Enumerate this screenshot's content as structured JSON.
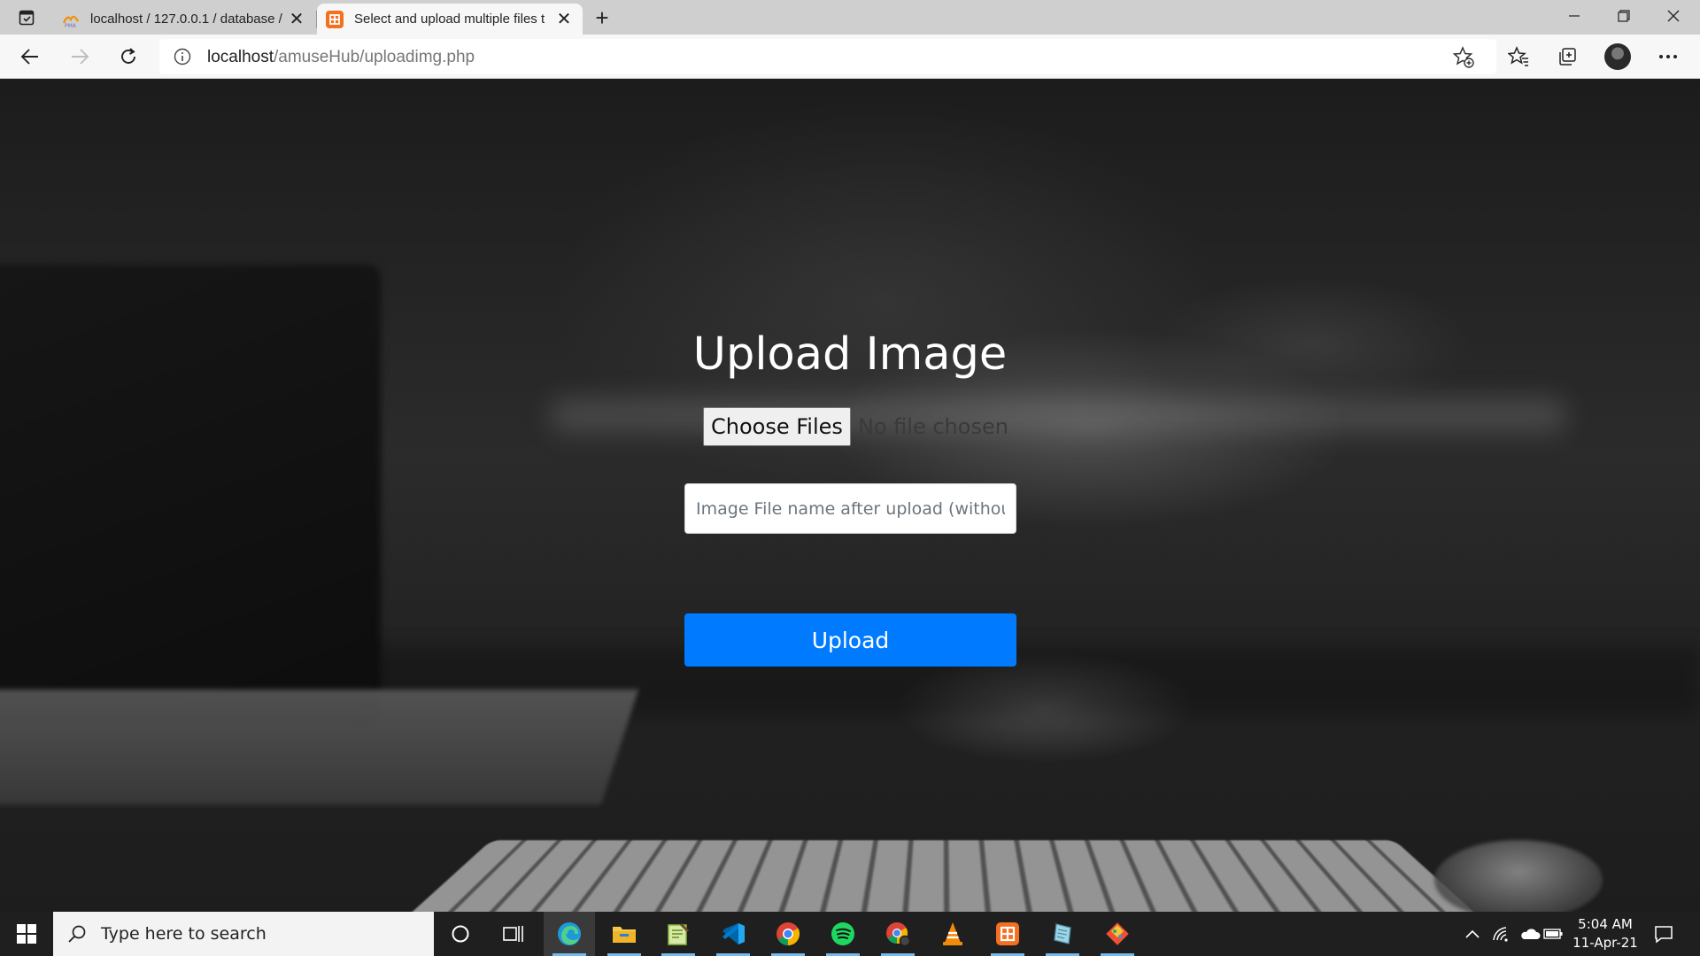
{
  "browser": {
    "tabs": [
      {
        "title": "localhost / 127.0.0.1 / database /",
        "active": false,
        "favicon": "phpmyadmin-icon"
      },
      {
        "title": "Select and upload multiple files t",
        "active": true,
        "favicon": "xampp-icon"
      }
    ],
    "url": {
      "host": "localhost",
      "path": "/amuseHub/uploadimg.php"
    }
  },
  "page": {
    "title": "Upload Image",
    "file_input": {
      "button_label": "Choose Files",
      "status": "No file chosen"
    },
    "name_input": {
      "placeholder": "Image File name after upload (without extension)",
      "value": ""
    },
    "submit_label": "Upload",
    "accent_color": "#007bff"
  },
  "taskbar": {
    "search_placeholder": "Type here to search",
    "apps": [
      "cortana-icon",
      "task-view-icon",
      "edge-icon",
      "file-explorer-icon",
      "notepad-plus-plus-icon",
      "vscode-icon",
      "chrome-icon",
      "spotify-icon",
      "chrome-profile-icon",
      "vlc-icon",
      "xampp-icon",
      "sublime-text-icon",
      "git-icon"
    ],
    "clock": {
      "time": "5:04 AM",
      "date": "11-Apr-21"
    }
  }
}
